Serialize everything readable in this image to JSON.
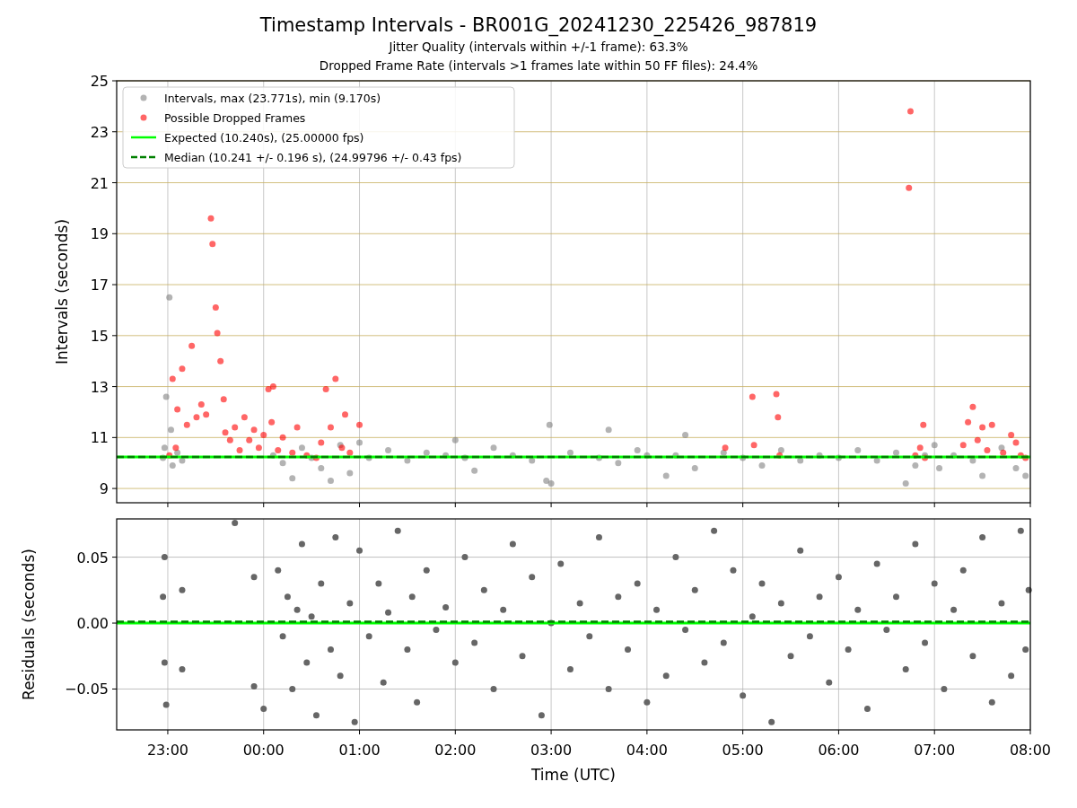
{
  "title": "Timestamp Intervals - BR001G_20241230_225426_987819",
  "subtitles": [
    "Jitter Quality (intervals within +/-1 frame): 63.3%",
    "Dropped Frame Rate (intervals >1 frames late within 50 FF files): 24.4%"
  ],
  "charts": [
    {
      "chart_data": {
        "type": "scatter",
        "ylabel": "Intervals (seconds)",
        "grid": true,
        "legend": true,
        "xlim": [
          "2024-12-30T22:28",
          "2024-12-31T08:00"
        ],
        "ylim": [
          8.44,
          25
        ],
        "yticks": [
          {
            "value": 9,
            "label": "9"
          },
          {
            "value": 11,
            "label": "11"
          },
          {
            "value": 13,
            "label": "13"
          },
          {
            "value": 15,
            "label": "15"
          },
          {
            "value": 17,
            "label": "17"
          },
          {
            "value": 19,
            "label": "19"
          },
          {
            "value": 21,
            "label": "21"
          },
          {
            "value": 23,
            "label": "23"
          },
          {
            "value": 25,
            "label": "25"
          }
        ],
        "series": [
          {
            "name": "Intervals, max (23.771s), min (9.170s)",
            "color": "#808080",
            "x": [
              "2024-12-30T22:57",
              "2024-12-30T22:58",
              "2024-12-30T22:59",
              "2024-12-30T23:01",
              "2024-12-30T23:02",
              "2024-12-30T23:03",
              "2024-12-30T23:06",
              "2024-12-30T23:09",
              "2024-12-31T00:06",
              "2024-12-31T00:12",
              "2024-12-31T00:18",
              "2024-12-31T00:24",
              "2024-12-31T00:30",
              "2024-12-31T00:36",
              "2024-12-31T00:42",
              "2024-12-31T00:48",
              "2024-12-31T00:54",
              "2024-12-31T01:00",
              "2024-12-31T01:06",
              "2024-12-31T01:18",
              "2024-12-31T01:30",
              "2024-12-31T01:42",
              "2024-12-31T01:54",
              "2024-12-31T02:00",
              "2024-12-31T02:06",
              "2024-12-31T02:12",
              "2024-12-31T02:24",
              "2024-12-31T02:36",
              "2024-12-31T02:48",
              "2024-12-31T02:57",
              "2024-12-31T02:59",
              "2024-12-31T03:00",
              "2024-12-31T03:12",
              "2024-12-31T03:30",
              "2024-12-31T03:36",
              "2024-12-31T03:42",
              "2024-12-31T03:54",
              "2024-12-31T04:00",
              "2024-12-31T04:12",
              "2024-12-31T04:18",
              "2024-12-31T04:24",
              "2024-12-31T04:30",
              "2024-12-31T04:48",
              "2024-12-31T05:00",
              "2024-12-31T05:12",
              "2024-12-31T05:24",
              "2024-12-31T05:36",
              "2024-12-31T05:48",
              "2024-12-31T06:00",
              "2024-12-31T06:12",
              "2024-12-31T06:24",
              "2024-12-31T06:36",
              "2024-12-31T06:42",
              "2024-12-31T06:48",
              "2024-12-31T06:54",
              "2024-12-31T07:00",
              "2024-12-31T07:03",
              "2024-12-31T07:12",
              "2024-12-31T07:24",
              "2024-12-31T07:30",
              "2024-12-31T07:42",
              "2024-12-31T07:51",
              "2024-12-31T07:57"
            ],
            "values": [
              10.2,
              10.6,
              12.6,
              16.5,
              11.3,
              9.9,
              10.4,
              10.1,
              10.3,
              10.0,
              9.4,
              10.6,
              10.2,
              9.8,
              9.3,
              10.7,
              9.6,
              10.8,
              10.2,
              10.5,
              10.1,
              10.4,
              10.3,
              10.9,
              10.2,
              9.7,
              10.6,
              10.3,
              10.1,
              9.3,
              11.5,
              9.2,
              10.4,
              10.2,
              11.3,
              10.0,
              10.5,
              10.3,
              9.5,
              10.3,
              11.1,
              9.8,
              10.4,
              10.2,
              9.9,
              10.5,
              10.1,
              10.3,
              10.2,
              10.5,
              10.1,
              10.4,
              9.2,
              9.9,
              10.3,
              10.7,
              9.8,
              10.3,
              10.1,
              9.5,
              10.6,
              9.8,
              9.5
            ]
          },
          {
            "name": "Possible Dropped Frames",
            "color": "#ff0000",
            "x": [
              "2024-12-30T23:01",
              "2024-12-30T23:03",
              "2024-12-30T23:05",
              "2024-12-30T23:06",
              "2024-12-30T23:09",
              "2024-12-30T23:12",
              "2024-12-30T23:15",
              "2024-12-30T23:18",
              "2024-12-30T23:21",
              "2024-12-30T23:24",
              "2024-12-30T23:27",
              "2024-12-30T23:28",
              "2024-12-30T23:30",
              "2024-12-30T23:31",
              "2024-12-30T23:33",
              "2024-12-30T23:35",
              "2024-12-30T23:36",
              "2024-12-30T23:39",
              "2024-12-30T23:42",
              "2024-12-30T23:45",
              "2024-12-30T23:48",
              "2024-12-30T23:51",
              "2024-12-30T23:54",
              "2024-12-30T23:57",
              "2024-12-31T00:00",
              "2024-12-31T00:03",
              "2024-12-31T00:05",
              "2024-12-31T00:06",
              "2024-12-31T00:09",
              "2024-12-31T00:12",
              "2024-12-31T00:18",
              "2024-12-31T00:21",
              "2024-12-31T00:27",
              "2024-12-31T00:33",
              "2024-12-31T00:36",
              "2024-12-31T00:39",
              "2024-12-31T00:42",
              "2024-12-31T00:45",
              "2024-12-31T00:49",
              "2024-12-31T00:51",
              "2024-12-31T00:54",
              "2024-12-31T01:00",
              "2024-12-31T04:49",
              "2024-12-31T05:06",
              "2024-12-31T05:07",
              "2024-12-31T05:21",
              "2024-12-31T05:22",
              "2024-12-31T05:23",
              "2024-12-31T06:44",
              "2024-12-31T06:45",
              "2024-12-31T06:48",
              "2024-12-31T06:51",
              "2024-12-31T06:53",
              "2024-12-31T06:54",
              "2024-12-31T07:18",
              "2024-12-31T07:21",
              "2024-12-31T07:24",
              "2024-12-31T07:27",
              "2024-12-31T07:30",
              "2024-12-31T07:33",
              "2024-12-31T07:36",
              "2024-12-31T07:43",
              "2024-12-31T07:48",
              "2024-12-31T07:51",
              "2024-12-31T07:54",
              "2024-12-31T07:57"
            ],
            "values": [
              10.3,
              13.3,
              10.6,
              12.1,
              13.7,
              11.5,
              14.6,
              11.8,
              12.3,
              11.9,
              19.6,
              18.6,
              16.1,
              15.1,
              14.0,
              12.5,
              11.2,
              10.9,
              11.4,
              10.5,
              11.8,
              10.9,
              11.3,
              10.6,
              11.1,
              12.9,
              11.6,
              13.0,
              10.5,
              11.0,
              10.4,
              11.4,
              10.3,
              10.2,
              10.8,
              12.9,
              11.4,
              13.3,
              10.6,
              11.9,
              10.4,
              11.5,
              10.6,
              12.6,
              10.7,
              12.7,
              11.8,
              10.3,
              20.8,
              23.8,
              10.3,
              10.6,
              11.5,
              10.2,
              10.7,
              11.6,
              12.2,
              10.9,
              11.4,
              10.5,
              11.5,
              10.4,
              11.1,
              10.8,
              10.3,
              10.2
            ]
          }
        ],
        "ref_lines": [
          {
            "axis": "y",
            "value": 10.24,
            "label": "Expected (10.240s), (25.00000 fps)"
          },
          {
            "axis": "y",
            "value": 10.241,
            "label": "Median (10.241 +/- 0.196 s), (24.99796 +/- 0.43 fps)"
          }
        ]
      }
    },
    {
      "chart_data": {
        "type": "scatter",
        "xlabel": "Time (UTC)",
        "ylabel": "Residuals (seconds)",
        "grid": true,
        "xlim": [
          "2024-12-30T22:28",
          "2024-12-31T08:00"
        ],
        "ylim": [
          -0.081,
          0.079
        ],
        "xticks": [
          {
            "value": "2024-12-30T23:00",
            "label": "23:00"
          },
          {
            "value": "2024-12-31T00:00",
            "label": "00:00"
          },
          {
            "value": "2024-12-31T01:00",
            "label": "01:00"
          },
          {
            "value": "2024-12-31T02:00",
            "label": "02:00"
          },
          {
            "value": "2024-12-31T03:00",
            "label": "03:00"
          },
          {
            "value": "2024-12-31T04:00",
            "label": "04:00"
          },
          {
            "value": "2024-12-31T05:00",
            "label": "05:00"
          },
          {
            "value": "2024-12-31T06:00",
            "label": "06:00"
          },
          {
            "value": "2024-12-31T07:00",
            "label": "07:00"
          },
          {
            "value": "2024-12-31T08:00",
            "label": "08:00"
          }
        ],
        "yticks": [
          {
            "value": 0.05,
            "label": "0.05"
          },
          {
            "value": 0,
            "label": "0.00"
          },
          {
            "value": -0.05,
            "label": "−0.05"
          }
        ],
        "series": [
          {
            "color": "#666666",
            "x": [
              "2024-12-30T22:57",
              "2024-12-30T22:58",
              "2024-12-30T22:58",
              "2024-12-30T22:59",
              "2024-12-30T23:09",
              "2024-12-30T23:09",
              "2024-12-30T23:42",
              "2024-12-30T23:54",
              "2024-12-30T23:54",
              "2024-12-31T00:00",
              "2024-12-31T00:09",
              "2024-12-31T00:12",
              "2024-12-31T00:15",
              "2024-12-31T00:18",
              "2024-12-31T00:21",
              "2024-12-31T00:24",
              "2024-12-31T00:27",
              "2024-12-31T00:30",
              "2024-12-31T00:33",
              "2024-12-31T00:36",
              "2024-12-31T00:42",
              "2024-12-31T00:45",
              "2024-12-31T00:48",
              "2024-12-31T00:54",
              "2024-12-31T00:57",
              "2024-12-31T01:00",
              "2024-12-31T01:06",
              "2024-12-31T01:12",
              "2024-12-31T01:15",
              "2024-12-31T01:18",
              "2024-12-31T01:24",
              "2024-12-31T01:30",
              "2024-12-31T01:33",
              "2024-12-31T01:36",
              "2024-12-31T01:42",
              "2024-12-31T01:48",
              "2024-12-31T01:54",
              "2024-12-31T02:00",
              "2024-12-31T02:06",
              "2024-12-31T02:12",
              "2024-12-31T02:18",
              "2024-12-31T02:24",
              "2024-12-31T02:30",
              "2024-12-31T02:36",
              "2024-12-31T02:42",
              "2024-12-31T02:48",
              "2024-12-31T02:54",
              "2024-12-31T03:00",
              "2024-12-31T03:06",
              "2024-12-31T03:12",
              "2024-12-31T03:18",
              "2024-12-31T03:24",
              "2024-12-31T03:30",
              "2024-12-31T03:36",
              "2024-12-31T03:42",
              "2024-12-31T03:48",
              "2024-12-31T03:54",
              "2024-12-31T04:00",
              "2024-12-31T04:06",
              "2024-12-31T04:12",
              "2024-12-31T04:18",
              "2024-12-31T04:24",
              "2024-12-31T04:30",
              "2024-12-31T04:36",
              "2024-12-31T04:42",
              "2024-12-31T04:48",
              "2024-12-31T04:54",
              "2024-12-31T05:00",
              "2024-12-31T05:06",
              "2024-12-31T05:12",
              "2024-12-31T05:18",
              "2024-12-31T05:24",
              "2024-12-31T05:30",
              "2024-12-31T05:36",
              "2024-12-31T05:42",
              "2024-12-31T05:48",
              "2024-12-31T05:54",
              "2024-12-31T06:00",
              "2024-12-31T06:06",
              "2024-12-31T06:12",
              "2024-12-31T06:18",
              "2024-12-31T06:24",
              "2024-12-31T06:30",
              "2024-12-31T06:36",
              "2024-12-31T06:42",
              "2024-12-31T06:48",
              "2024-12-31T06:54",
              "2024-12-31T07:00",
              "2024-12-31T07:06",
              "2024-12-31T07:12",
              "2024-12-31T07:18",
              "2024-12-31T07:24",
              "2024-12-31T07:30",
              "2024-12-31T07:36",
              "2024-12-31T07:42",
              "2024-12-31T07:48",
              "2024-12-31T07:54",
              "2024-12-31T07:57",
              "2024-12-31T07:59"
            ],
            "values": [
              0.02,
              -0.03,
              0.05,
              -0.062,
              -0.035,
              0.025,
              0.076,
              -0.048,
              0.035,
              -0.065,
              0.04,
              -0.01,
              0.02,
              -0.05,
              0.01,
              0.06,
              -0.03,
              0.005,
              -0.07,
              0.03,
              -0.02,
              0.065,
              -0.04,
              0.015,
              -0.075,
              0.055,
              -0.01,
              0.03,
              -0.045,
              0.008,
              0.07,
              -0.02,
              0.02,
              -0.06,
              0.04,
              -0.005,
              0.012,
              -0.03,
              0.05,
              -0.015,
              0.025,
              -0.05,
              0.01,
              0.06,
              -0.025,
              0.035,
              -0.07,
              0.0,
              0.045,
              -0.035,
              0.015,
              -0.01,
              0.065,
              -0.05,
              0.02,
              -0.02,
              0.03,
              -0.06,
              0.01,
              -0.04,
              0.05,
              -0.005,
              0.025,
              -0.03,
              0.07,
              -0.015,
              0.04,
              -0.055,
              0.005,
              0.03,
              -0.075,
              0.015,
              -0.025,
              0.055,
              -0.01,
              0.02,
              -0.045,
              0.035,
              -0.02,
              0.01,
              -0.065,
              0.045,
              -0.005,
              0.02,
              -0.035,
              0.06,
              -0.015,
              0.03,
              -0.05,
              0.01,
              0.04,
              -0.025,
              0.065,
              -0.06,
              0.015,
              -0.04,
              0.07,
              -0.02,
              0.025
            ]
          }
        ],
        "ref_lines": [
          {
            "axis": "y",
            "value": 0
          },
          {
            "axis": "y",
            "value": 0.001
          }
        ]
      }
    }
  ]
}
